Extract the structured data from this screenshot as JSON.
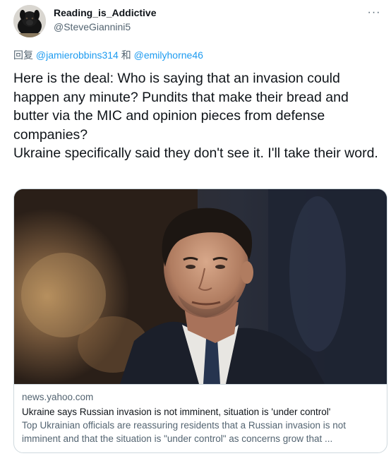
{
  "tweet": {
    "display_name": "Reading_is_Addictive",
    "handle": "@SteveGiannini5",
    "more_glyph": "···",
    "reply_prefix": "回复",
    "reply_mention_1": "@jamierobbins314",
    "reply_joiner": "和",
    "reply_mention_2": "@emilyhorne46",
    "text": "Here is the deal: Who is saying that an invasion could happen any minute? Pundits that make their bread and butter via the MIC and opinion pieces from defense companies?\nUkraine specifically said they don't see it. I'll take their word."
  },
  "card": {
    "domain": "news.yahoo.com",
    "title": "Ukraine says Russian invasion is not imminent, situation is 'under control'",
    "description": "Top Ukrainian officials are reassuring residents that a Russian invasion is not imminent and that the situation is \"under control\" as concerns grow that ..."
  },
  "colors": {
    "link": "#1d9bf0",
    "secondary_text": "#536471",
    "primary_text": "#0f1419",
    "border": "#cfd9de"
  },
  "icons": {
    "more": "more-options-icon"
  }
}
